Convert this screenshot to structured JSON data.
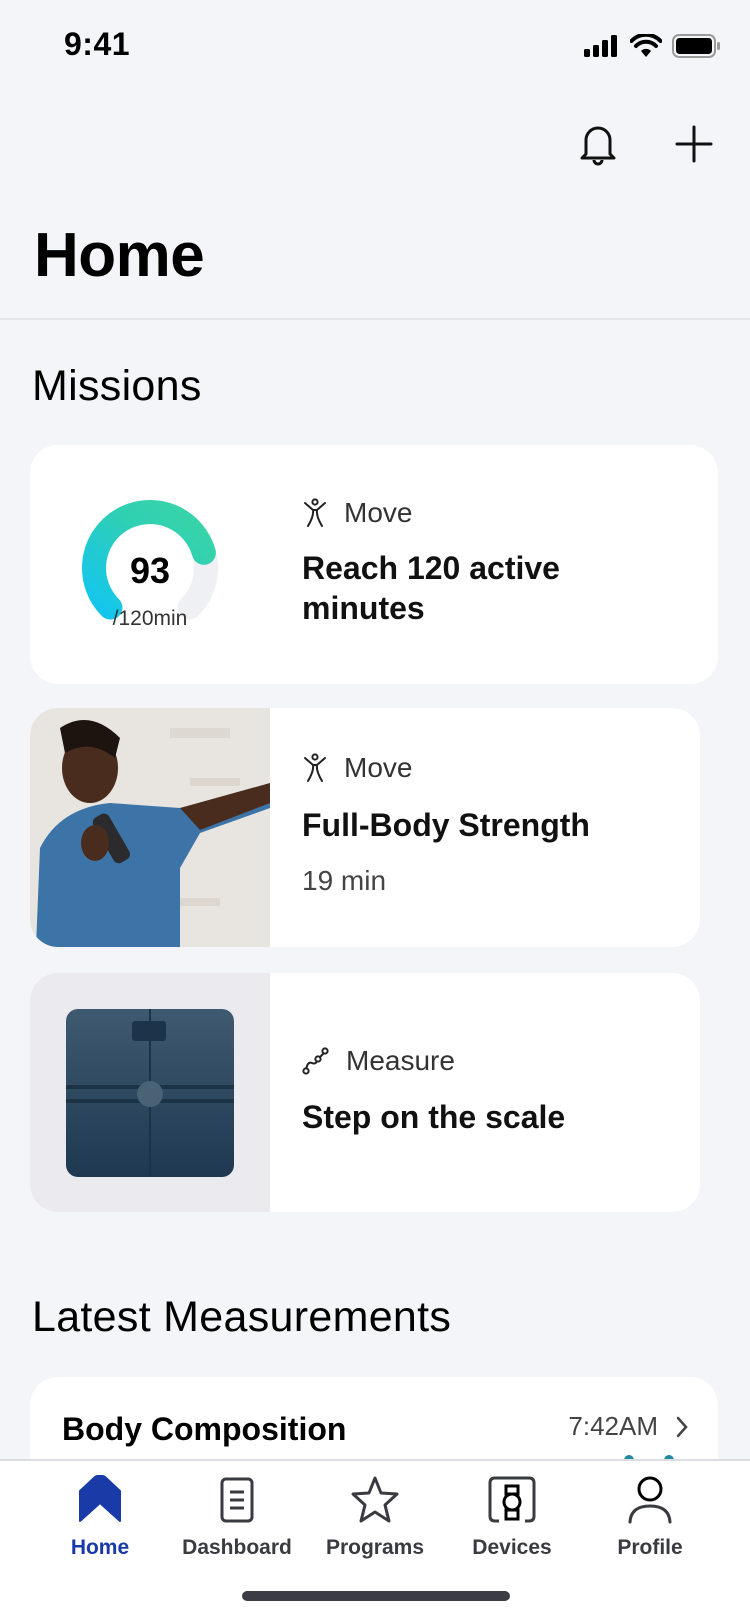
{
  "status_bar": {
    "time": "9:41"
  },
  "header": {
    "title": "Home",
    "actions": [
      {
        "icon": "bell-icon",
        "label": "Notifications"
      },
      {
        "icon": "plus-icon",
        "label": "Add"
      }
    ]
  },
  "missions": {
    "title": "Missions",
    "items": [
      {
        "category": "Move",
        "category_icon": "move-figure-icon",
        "title_line1": "Reach 120 active",
        "title_line2": "minutes",
        "progress": {
          "value": "93",
          "goal_label": "/120min",
          "current": 93,
          "goal": 120
        }
      },
      {
        "category": "Move",
        "category_icon": "move-figure-icon",
        "title": "Full-Body Strength",
        "duration": "19 min",
        "image": "man-with-dumbbell-photo"
      },
      {
        "category": "Measure",
        "category_icon": "measure-graph-icon",
        "title": "Step on the scale",
        "image": "smart-scale-image"
      }
    ]
  },
  "latest_measurements": {
    "title": "Latest Measurements",
    "items": [
      {
        "title": "Body Composition",
        "time": "7:42AM"
      }
    ]
  },
  "tab_bar": {
    "active": "Home",
    "accent_color": "#1a3aa8",
    "tabs": [
      {
        "label": "Home",
        "icon": "home-icon"
      },
      {
        "label": "Dashboard",
        "icon": "dashboard-icon"
      },
      {
        "label": "Programs",
        "icon": "star-icon"
      },
      {
        "label": "Devices",
        "icon": "watch-device-icon"
      },
      {
        "label": "Profile",
        "icon": "profile-icon"
      }
    ]
  }
}
